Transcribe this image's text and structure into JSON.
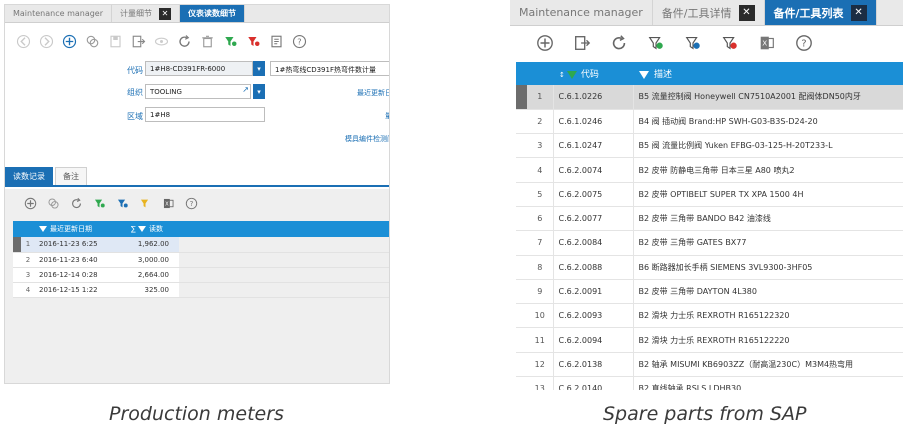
{
  "left": {
    "tabs": [
      {
        "label": "Maintenance manager",
        "active": false,
        "closable": false
      },
      {
        "label": "计量细节",
        "active": false,
        "closable": true
      },
      {
        "label": "仪表读数细节",
        "active": true,
        "closable": false
      }
    ],
    "form": {
      "code_label": "代码",
      "code_value": "1#H8-CD391FR-6000",
      "code_desc": "1#热弯线CD391F热弯件数计量",
      "org_label": "组织",
      "org_value": "TOOLING",
      "area_label": "区域",
      "area_value": "1#H8",
      "link_last_update": "最近更新日",
      "link_2": "量",
      "link_template": "模具编件检测间"
    },
    "subtabs": [
      "读数记录",
      "备注"
    ],
    "table": {
      "headers": [
        "最近更新日期",
        "∑",
        "读数"
      ],
      "rows": [
        {
          "index": "1",
          "date": "2016-11-23 6:25",
          "value": "1,962.00"
        },
        {
          "index": "2",
          "date": "2016-11-23 6:40",
          "value": "3,000.00"
        },
        {
          "index": "3",
          "date": "2016-12-14 0:28",
          "value": "2,664.00"
        },
        {
          "index": "4",
          "date": "2016-12-15 1:22",
          "value": "325.00"
        }
      ]
    },
    "caption": "Production meters"
  },
  "right": {
    "tabs": [
      {
        "label": "Maintenance manager",
        "active": false,
        "closable": false
      },
      {
        "label": "备件/工具详情",
        "active": false,
        "closable": true
      },
      {
        "label": "备件/工具列表",
        "active": true,
        "closable": true
      }
    ],
    "table": {
      "headers": [
        "代码",
        "描述"
      ],
      "rows": [
        {
          "index": "1",
          "code": "C.6.1.0226",
          "desc": "B5 流量控制阀 Honeywell CN7510A2001 配阀体DN50内牙"
        },
        {
          "index": "2",
          "code": "C.6.1.0246",
          "desc": "B4 阀 插动阀 Brand:HP SWH-G03-B3S-D24-20"
        },
        {
          "index": "3",
          "code": "C.6.1.0247",
          "desc": "B5 阀 流量比例阀 Yuken EFBG-03-125-H-20T233-L"
        },
        {
          "index": "4",
          "code": "C.6.2.0074",
          "desc": "B2 皮带 防静电三角带 日本三星 A80 喷丸2"
        },
        {
          "index": "5",
          "code": "C.6.2.0075",
          "desc": "B2 皮带 OPTIBELT SUPER TX XPA 1500 4H"
        },
        {
          "index": "6",
          "code": "C.6.2.0077",
          "desc": "B2 皮带 三角带 BANDO B42 油漆线"
        },
        {
          "index": "7",
          "code": "C.6.2.0084",
          "desc": "B2 皮带 三角带 GATES BX77"
        },
        {
          "index": "8",
          "code": "C.6.2.0088",
          "desc": "B6 断路器加长手柄 SIEMENS 3VL9300-3HF05"
        },
        {
          "index": "9",
          "code": "C.6.2.0091",
          "desc": "B2 皮带 三角带 DAYTON 4L380"
        },
        {
          "index": "10",
          "code": "C.6.2.0093",
          "desc": "B2 滑块 力士乐 REXROTH R165122320"
        },
        {
          "index": "11",
          "code": "C.6.2.0094",
          "desc": "B2 滑块 力士乐 REXROTH R165122220"
        },
        {
          "index": "12",
          "code": "C.6.2.0138",
          "desc": "B2 轴承 MISUMI KB6903ZZ（耐高温230C）M3M4热弯用"
        },
        {
          "index": "13",
          "code": "C.6.2.0140",
          "desc": "B2 直线轴承 RSLS LDHB30"
        }
      ]
    },
    "caption": "Spare parts from SAP"
  },
  "colors": {
    "accent": "#1b6fb4",
    "header": "#1b8fd6",
    "filter_green": "#2fa84f",
    "filter_red": "#d9302c",
    "filter_yellow": "#e8b320"
  }
}
